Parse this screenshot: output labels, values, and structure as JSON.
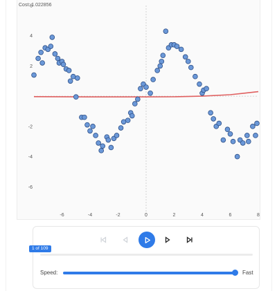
{
  "cost": {
    "label": "Cost: 1.022856"
  },
  "chart_data": {
    "type": "scatter",
    "title": "",
    "xlabel": "",
    "ylabel": "",
    "xlim": [
      -8,
      8
    ],
    "ylim": [
      -8,
      6
    ],
    "xticks": [
      -6,
      -4,
      -2,
      0,
      2,
      4,
      6,
      8
    ],
    "yticks": [
      6,
      4,
      2,
      -2,
      -4,
      -6
    ],
    "grid": true,
    "series": [
      {
        "kind": "points",
        "color": "#6b98d8",
        "points": [
          [
            -8.0,
            1.4
          ],
          [
            -7.7,
            2.5
          ],
          [
            -7.5,
            2.9
          ],
          [
            -7.4,
            2.2
          ],
          [
            -7.2,
            3.2
          ],
          [
            -7.0,
            3.1
          ],
          [
            -6.8,
            3.3
          ],
          [
            -6.7,
            3.9
          ],
          [
            -6.5,
            2.8
          ],
          [
            -6.3,
            2.5
          ],
          [
            -6.2,
            2.2
          ],
          [
            -6.0,
            2.3
          ],
          [
            -5.9,
            2.1
          ],
          [
            -5.7,
            1.8
          ],
          [
            -5.5,
            1.7
          ],
          [
            -5.4,
            1.0
          ],
          [
            -5.2,
            1.3
          ],
          [
            -5.0,
            -0.05
          ],
          [
            -4.9,
            1.2
          ],
          [
            -4.6,
            -1.4
          ],
          [
            -4.4,
            -1.4
          ],
          [
            -4.2,
            -1.9
          ],
          [
            -4.0,
            -2.3
          ],
          [
            -3.8,
            -2.0
          ],
          [
            -3.6,
            -2.6
          ],
          [
            -3.4,
            -3.1
          ],
          [
            -3.2,
            -3.6
          ],
          [
            -3.1,
            -3.3
          ],
          [
            -2.8,
            -2.7
          ],
          [
            -2.7,
            -2.9
          ],
          [
            -2.5,
            -3.4
          ],
          [
            -2.3,
            -2.8
          ],
          [
            -2.1,
            -2.6
          ],
          [
            -1.8,
            -2.1
          ],
          [
            -1.6,
            -1.7
          ],
          [
            -1.3,
            -1.6
          ],
          [
            -1.1,
            -1.1
          ],
          [
            -1.0,
            -1.3
          ],
          [
            -0.8,
            -0.5
          ],
          [
            -0.6,
            -0.2
          ],
          [
            -0.4,
            0.5
          ],
          [
            -0.2,
            0.8
          ],
          [
            0.0,
            0.6
          ],
          [
            0.3,
            0.2
          ],
          [
            0.5,
            1.1
          ],
          [
            0.8,
            1.7
          ],
          [
            1.0,
            2.0
          ],
          [
            1.1,
            2.3
          ],
          [
            1.2,
            2.7
          ],
          [
            1.4,
            4.3
          ],
          [
            1.6,
            3.2
          ],
          [
            1.8,
            3.4
          ],
          [
            2.0,
            3.4
          ],
          [
            2.2,
            3.3
          ],
          [
            2.5,
            3.1
          ],
          [
            2.8,
            2.6
          ],
          [
            3.0,
            2.3
          ],
          [
            3.2,
            1.9
          ],
          [
            3.5,
            1.3
          ],
          [
            3.8,
            0.8
          ],
          [
            4.0,
            0.2
          ],
          [
            4.1,
            0.4
          ],
          [
            4.3,
            0.5
          ],
          [
            4.6,
            -1.1
          ],
          [
            4.8,
            -1.5
          ],
          [
            5.0,
            -2.0
          ],
          [
            5.2,
            -1.8
          ],
          [
            5.5,
            -2.9
          ],
          [
            5.8,
            -2.2
          ],
          [
            6.0,
            -2.5
          ],
          [
            6.2,
            -3.0
          ],
          [
            6.5,
            -4.0
          ],
          [
            6.7,
            -2.9
          ],
          [
            6.9,
            -3.1
          ],
          [
            7.2,
            -2.6
          ],
          [
            7.3,
            -3.0
          ],
          [
            7.6,
            -2.0
          ],
          [
            7.8,
            -2.6
          ],
          [
            7.9,
            -1.8
          ]
        ]
      },
      {
        "kind": "fitted-line",
        "color": "#e06060",
        "points": [
          [
            -8,
            -0.03
          ],
          [
            -4,
            -0.05
          ],
          [
            0,
            -0.05
          ],
          [
            2,
            -0.04
          ],
          [
            4,
            0.0
          ],
          [
            6,
            0.1
          ],
          [
            7,
            0.2
          ],
          [
            8,
            0.3
          ]
        ]
      }
    ]
  },
  "playback": {
    "frame_label": "1 of 109",
    "progress": 0.0,
    "speed_label": "Speed:",
    "fast_label": "Fast",
    "speed_value": 1.0,
    "accent_color": "#2f7be8"
  }
}
